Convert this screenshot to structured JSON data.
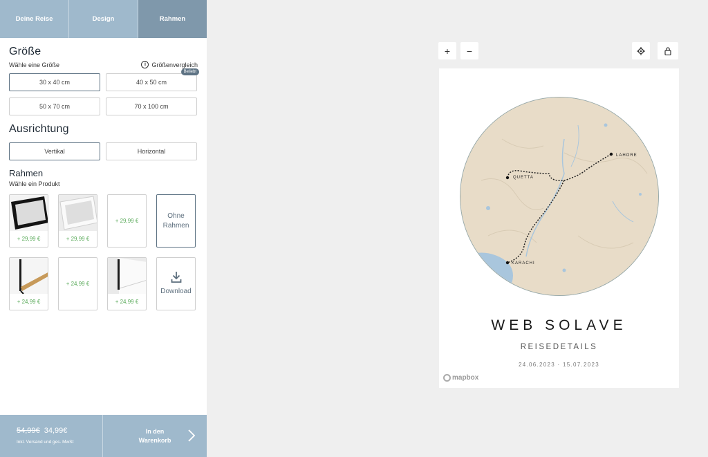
{
  "tabs": [
    {
      "label": "Deine Reise",
      "active": false
    },
    {
      "label": "Design",
      "active": false
    },
    {
      "label": "Rahmen",
      "active": true
    }
  ],
  "size": {
    "title": "Größe",
    "subtitle": "Wähle eine Größe",
    "compare_label": "Größenvergleich",
    "info_icon": "info-icon",
    "badge": "Beliebt",
    "options": [
      "30 x 40 cm",
      "40 x 50 cm",
      "50 x 70 cm",
      "70 x 100 cm"
    ],
    "selected": "30 x 40 cm"
  },
  "orientation": {
    "title": "Ausrichtung",
    "options": [
      "Vertikal",
      "Horizontal"
    ],
    "selected": "Vertikal"
  },
  "frames": {
    "title": "Rahmen",
    "subtitle": "Wähle ein Produkt",
    "items": [
      {
        "price": "+ 29,99 €",
        "style": "black"
      },
      {
        "price": "+ 29,99 €",
        "style": "white"
      },
      {
        "price": "+ 29,99 €",
        "style": "none"
      },
      {
        "label": "Ohne Rahmen",
        "selected": true
      },
      {
        "price": "+ 24,99 €",
        "style": "hanger-wood"
      },
      {
        "price": "+ 24,99 €",
        "style": "none"
      },
      {
        "price": "+ 24,99 €",
        "style": "hanger-black"
      },
      {
        "label": "Download",
        "icon": "download-icon"
      }
    ]
  },
  "footer": {
    "old_price": "54,99€",
    "new_price": "34,99€",
    "incl": "Inkl. Versand und ges. MwSt",
    "cart_line1": "In den",
    "cart_line2": "Warenkorb"
  },
  "map_controls": {
    "zoom_in": "+",
    "zoom_out": "−",
    "locate_icon": "crosshair-icon",
    "lock_icon": "lock-icon"
  },
  "poster": {
    "title": "WEB SOLAVE",
    "subtitle": "REISEDETAILS",
    "dates": "24.06.2023 · 15.07.2023",
    "places": [
      "QUETTA",
      "LAHORE",
      "KARACHI"
    ],
    "attribution": "mapbox"
  },
  "colors": {
    "accent": "#9fb9cc",
    "accent_dark": "#7f98ab",
    "price_green": "#5aaa5a",
    "map_land": "#e8dcc8",
    "map_water": "#a9c6dd"
  }
}
